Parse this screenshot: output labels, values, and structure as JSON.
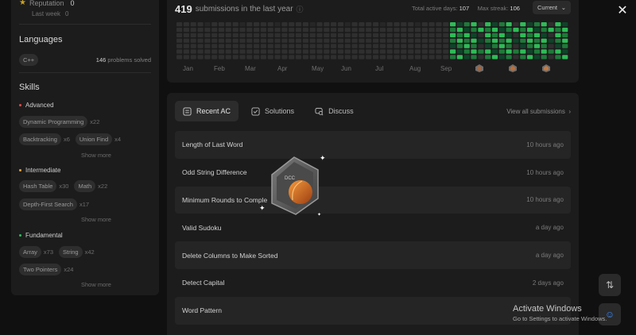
{
  "profile": {
    "reputation_label": "Reputation",
    "reputation_value": "0",
    "last_week_label": "Last week",
    "last_week_value": "0",
    "languages_title": "Languages",
    "language": "C++",
    "language_solved_count": "146",
    "language_solved_label": "problems solved",
    "skills_title": "Skills",
    "advanced_title": "Advanced",
    "intermediate_title": "Intermediate",
    "fundamental_title": "Fundamental",
    "show_more": "Show more",
    "advanced": [
      {
        "name": "Dynamic Programming",
        "count": "x22"
      },
      {
        "name": "Backtracking",
        "count": "x6"
      },
      {
        "name": "Union Find",
        "count": "x4"
      }
    ],
    "intermediate": [
      {
        "name": "Hash Table",
        "count": "x30"
      },
      {
        "name": "Math",
        "count": "x22"
      },
      {
        "name": "Depth-First Search",
        "count": "x17"
      }
    ],
    "fundamental": [
      {
        "name": "Array",
        "count": "x73"
      },
      {
        "name": "String",
        "count": "x42"
      },
      {
        "name": "Two Pointers",
        "count": "x24"
      }
    ],
    "colors": {
      "advanced": "#e04a4a",
      "intermediate": "#e0a23a",
      "fundamental": "#2cbb5d"
    }
  },
  "calendar": {
    "submissions_count": "419",
    "submissions_label": "submissions in the last year",
    "total_active_label": "Total active days:",
    "total_active_value": "107",
    "max_streak_label": "Max streak:",
    "max_streak_value": "106",
    "range_select": "Current",
    "months": [
      "Jan",
      "Feb",
      "Mar",
      "Apr",
      "May",
      "Jun",
      "Jul",
      "Aug",
      "Sep"
    ],
    "colors": {
      "empty": "#2f2f2f",
      "low": "#0e4429",
      "mid": "#1f7a3a",
      "high": "#2fbb57"
    }
  },
  "submissions": {
    "tabs": [
      {
        "label": "Recent AC",
        "icon": "list-icon"
      },
      {
        "label": "Solutions",
        "icon": "check-square-icon"
      },
      {
        "label": "Discuss",
        "icon": "discuss-icon"
      }
    ],
    "view_all": "View all submissions",
    "items": [
      {
        "title": "Length of Last Word",
        "time": "10 hours ago"
      },
      {
        "title": "Odd String Difference",
        "time": "10 hours ago"
      },
      {
        "title": "Minimum Rounds to Comple",
        "time": "10 hours ago"
      },
      {
        "title": "Valid Sudoku",
        "time": "a day ago"
      },
      {
        "title": "Delete Columns to Make Sorted",
        "time": "a day ago"
      },
      {
        "title": "Detect Capital",
        "time": "2 days ago"
      },
      {
        "title": "Word Pattern",
        "time": ""
      }
    ]
  },
  "badge": {
    "label": "DCC"
  },
  "windows": {
    "title": "Activate Windows",
    "subtitle": "Go to Settings to activate Windows."
  }
}
